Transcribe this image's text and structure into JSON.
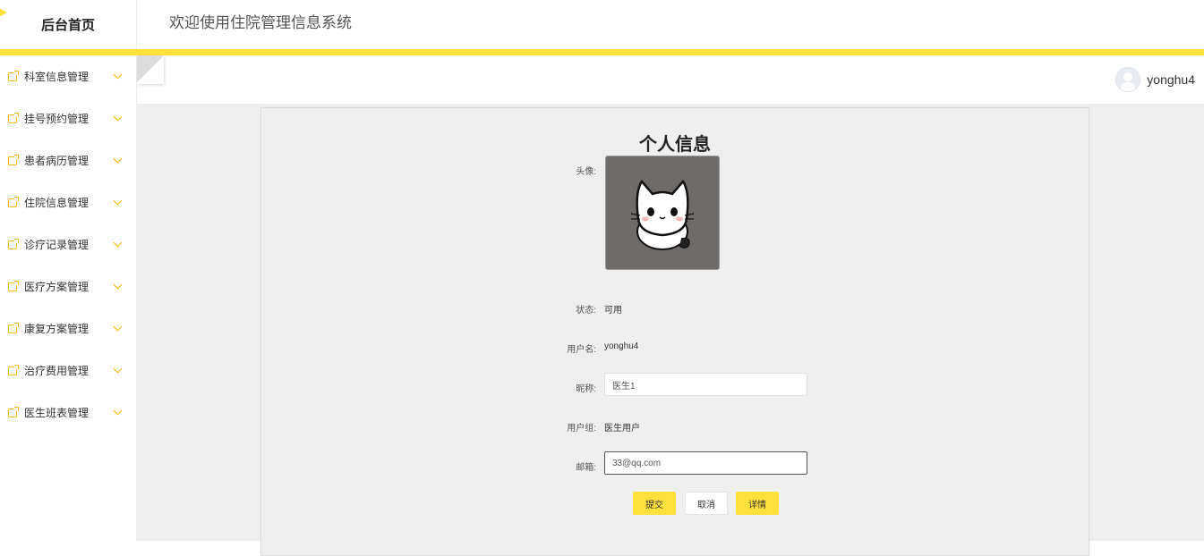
{
  "header": {
    "brand": "后台首页",
    "system_title": "欢迎使用住院管理信息系统"
  },
  "sidebar": {
    "items": [
      {
        "label": "科室信息管理"
      },
      {
        "label": "挂号预约管理"
      },
      {
        "label": "患者病历管理"
      },
      {
        "label": "住院信息管理"
      },
      {
        "label": "诊疗记录管理"
      },
      {
        "label": "医疗方案管理"
      },
      {
        "label": "康复方案管理"
      },
      {
        "label": "治疗费用管理"
      },
      {
        "label": "医生班表管理"
      }
    ]
  },
  "user": {
    "name": "yonghu4"
  },
  "profile": {
    "title": "个人信息",
    "avatar_label": "头像:",
    "status_label": "状态:",
    "status_value": "可用",
    "username_label": "用户名:",
    "username_value": "yonghu4",
    "nickname_label": "昵称:",
    "nickname_value": "医生1",
    "group_label": "用户组:",
    "group_value": "医生用户",
    "email_label": "邮箱:",
    "email_value": "33@qq.com"
  },
  "actions": {
    "submit": "提交",
    "cancel": "取消",
    "details": "详情"
  },
  "colors": {
    "accent": "#ffe13c",
    "icon": "#f5b700",
    "content_bg": "#efefef"
  },
  "icons": {
    "menu_item": "external-link-icon",
    "menu_expand": "chevron-down-icon",
    "sidebar_toggle": "fold-icon",
    "user_avatar": "user-avatar-icon"
  }
}
